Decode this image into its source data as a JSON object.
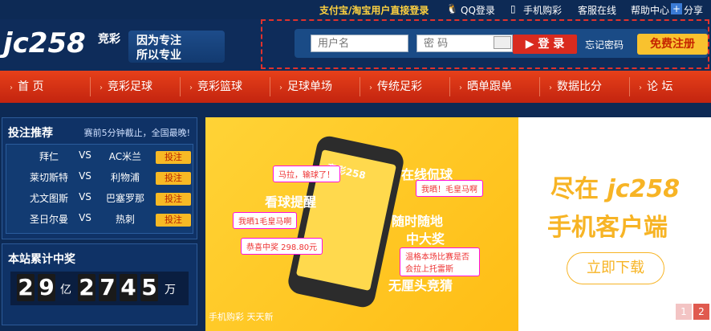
{
  "topbar": {
    "alipay": "支付宝/淘宝用户直接登录",
    "qq_login": "QQ登录",
    "mobile_buy": "手机购彩",
    "service": "客服在线",
    "help": "帮助中心",
    "share": "分享"
  },
  "logo": {
    "text": "jc258",
    "subtitle": "竞彩"
  },
  "slogan": {
    "line1": "因为专注",
    "line2": "所以专业"
  },
  "login": {
    "username_placeholder": "用户名",
    "password_placeholder": "密 码",
    "login_button": "登 录",
    "forgot": "忘记密码",
    "register": "免费注册"
  },
  "nav": {
    "items": [
      "首 页",
      "竞彩足球",
      "竞彩篮球",
      "足球单场",
      "传统足彩",
      "晒单跟单",
      "数据比分",
      "论 坛"
    ]
  },
  "picks": {
    "title": "投注推荐",
    "note": "赛前5分钟截止，全国最晚!",
    "vs": "VS",
    "bet": "投注",
    "rows": [
      {
        "home": "拜仁",
        "away": "AC米兰"
      },
      {
        "home": "莱切斯特",
        "away": "利物浦"
      },
      {
        "home": "尤文图斯",
        "away": "巴塞罗那"
      },
      {
        "home": "圣日尔曼",
        "away": "热刺"
      }
    ]
  },
  "prize": {
    "title": "本站累计中奖",
    "digits": [
      "2",
      "9",
      "2",
      "7",
      "4",
      "5"
    ],
    "unit1": "亿",
    "unit2": "万"
  },
  "banner": {
    "phone_title": "竞彩258",
    "t_online": "在线侃球",
    "t_watch": "看球提醒",
    "t_anytime": "随时随地",
    "t_big": "中大奖",
    "t_free": "无厘头竞猜",
    "bubble1": "我晒！毛皇马啊",
    "bubble2": "马拉，输球了！",
    "bubble3": "我晒1毛皇马啊",
    "bubble4": "恭喜中奖 298.80元",
    "bubble5": "温格本场比赛是否会拉上托雷斯",
    "caption": "手机购彩 天天新",
    "right_line1": "尽在",
    "right_brand": "jc258",
    "right_line2": "手机客户端",
    "download": "立即下载",
    "pages": [
      "1",
      "2"
    ]
  },
  "colors": {
    "nav": "#d3301a",
    "dark_blue": "#0d2a55",
    "accent_yellow": "#f7b425"
  }
}
